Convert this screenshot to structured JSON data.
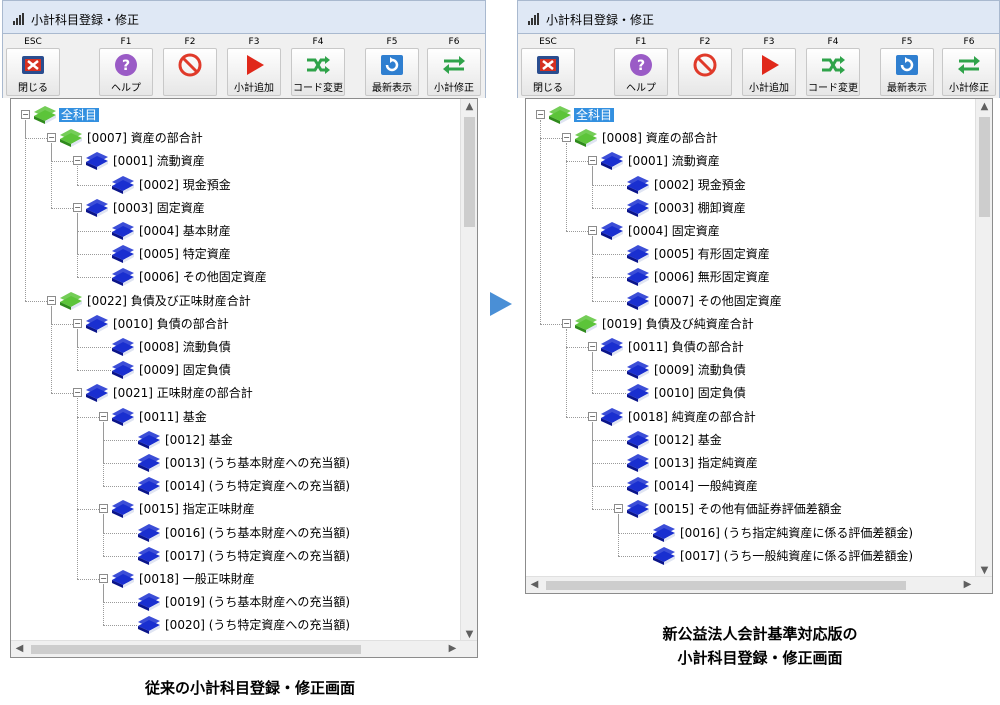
{
  "colors": {
    "accent": "#3390e0",
    "book_blue": "#1a2fd0",
    "book_green": "#5cc43a",
    "arrow": "#4a8fd6"
  },
  "left": {
    "title": "小計科目登録・修正",
    "toolbar": [
      {
        "key": "ESC",
        "label": "閉じる",
        "icon": "close-icon"
      },
      {
        "key": "F1",
        "label": "ヘルプ",
        "icon": "help-icon"
      },
      {
        "key": "F2",
        "label": "",
        "icon": "prohibit-icon"
      },
      {
        "key": "F3",
        "label": "小計追加",
        "icon": "play-icon"
      },
      {
        "key": "F4",
        "label": "コード変更",
        "icon": "shuffle-icon"
      },
      {
        "key": "F5",
        "label": "最新表示",
        "icon": "refresh-icon"
      },
      {
        "key": "F6",
        "label": "小計修正",
        "icon": "swap-icon"
      }
    ],
    "tree": [
      {
        "level": 0,
        "text": "全科目",
        "color": "green",
        "exp": true,
        "sel": true
      },
      {
        "level": 1,
        "text": "[0007] 資産の部合計",
        "color": "green",
        "exp": true
      },
      {
        "level": 2,
        "text": "[0001] 流動資産",
        "color": "blue",
        "exp": true
      },
      {
        "level": 3,
        "text": "[0002] 現金預金",
        "color": "blue"
      },
      {
        "level": 2,
        "text": "[0003] 固定資産",
        "color": "blue",
        "exp": true
      },
      {
        "level": 3,
        "text": "[0004] 基本財産",
        "color": "blue"
      },
      {
        "level": 3,
        "text": "[0005] 特定資産",
        "color": "blue"
      },
      {
        "level": 3,
        "text": "[0006] その他固定資産",
        "color": "blue"
      },
      {
        "level": 1,
        "text": "[0022] 負債及び正味財産合計",
        "color": "green",
        "exp": true
      },
      {
        "level": 2,
        "text": "[0010] 負債の部合計",
        "color": "blue",
        "exp": true
      },
      {
        "level": 3,
        "text": "[0008] 流動負債",
        "color": "blue"
      },
      {
        "level": 3,
        "text": "[0009] 固定負債",
        "color": "blue"
      },
      {
        "level": 2,
        "text": "[0021] 正味財産の部合計",
        "color": "blue",
        "exp": true
      },
      {
        "level": 3,
        "text": "[0011] 基金",
        "color": "blue",
        "exp": true
      },
      {
        "level": 4,
        "text": "[0012] 基金",
        "color": "blue"
      },
      {
        "level": 4,
        "text": "[0013] (うち基本財産への充当額)",
        "color": "blue"
      },
      {
        "level": 4,
        "text": "[0014] (うち特定資産への充当額)",
        "color": "blue"
      },
      {
        "level": 3,
        "text": "[0015] 指定正味財産",
        "color": "blue",
        "exp": true
      },
      {
        "level": 4,
        "text": "[0016] (うち基本財産への充当額)",
        "color": "blue"
      },
      {
        "level": 4,
        "text": "[0017] (うち特定資産への充当額)",
        "color": "blue"
      },
      {
        "level": 3,
        "text": "[0018] 一般正味財産",
        "color": "blue",
        "exp": true
      },
      {
        "level": 4,
        "text": "[0019] (うち基本財産への充当額)",
        "color": "blue"
      },
      {
        "level": 4,
        "text": "[0020] (うち特定資産への充当額)",
        "color": "blue"
      }
    ]
  },
  "right": {
    "title": "小計科目登録・修正",
    "toolbar": [
      {
        "key": "ESC",
        "label": "閉じる",
        "icon": "close-icon"
      },
      {
        "key": "F1",
        "label": "ヘルプ",
        "icon": "help-icon"
      },
      {
        "key": "F2",
        "label": "",
        "icon": "prohibit-icon"
      },
      {
        "key": "F3",
        "label": "小計追加",
        "icon": "play-icon"
      },
      {
        "key": "F4",
        "label": "コード変更",
        "icon": "shuffle-icon"
      },
      {
        "key": "F5",
        "label": "最新表示",
        "icon": "refresh-icon"
      },
      {
        "key": "F6",
        "label": "小計修正",
        "icon": "swap-icon"
      }
    ],
    "tree": [
      {
        "level": 0,
        "text": "全科目",
        "color": "green",
        "exp": true,
        "sel": true
      },
      {
        "level": 1,
        "text": "[0008] 資産の部合計",
        "color": "green",
        "exp": true
      },
      {
        "level": 2,
        "text": "[0001] 流動資産",
        "color": "blue",
        "exp": true
      },
      {
        "level": 3,
        "text": "[0002] 現金預金",
        "color": "blue"
      },
      {
        "level": 3,
        "text": "[0003] 棚卸資産",
        "color": "blue"
      },
      {
        "level": 2,
        "text": "[0004] 固定資産",
        "color": "blue",
        "exp": true
      },
      {
        "level": 3,
        "text": "[0005] 有形固定資産",
        "color": "blue"
      },
      {
        "level": 3,
        "text": "[0006] 無形固定資産",
        "color": "blue"
      },
      {
        "level": 3,
        "text": "[0007] その他固定資産",
        "color": "blue"
      },
      {
        "level": 1,
        "text": "[0019] 負債及び純資産合計",
        "color": "green",
        "exp": true
      },
      {
        "level": 2,
        "text": "[0011] 負債の部合計",
        "color": "blue",
        "exp": true
      },
      {
        "level": 3,
        "text": "[0009] 流動負債",
        "color": "blue"
      },
      {
        "level": 3,
        "text": "[0010] 固定負債",
        "color": "blue"
      },
      {
        "level": 2,
        "text": "[0018] 純資産の部合計",
        "color": "blue",
        "exp": true
      },
      {
        "level": 3,
        "text": "[0012] 基金",
        "color": "blue"
      },
      {
        "level": 3,
        "text": "[0013] 指定純資産",
        "color": "blue"
      },
      {
        "level": 3,
        "text": "[0014] 一般純資産",
        "color": "blue"
      },
      {
        "level": 3,
        "text": "[0015] その他有価証券評価差額金",
        "color": "blue",
        "exp": true
      },
      {
        "level": 4,
        "text": "[0016] (うち指定純資産に係る評価差額金)",
        "color": "blue"
      },
      {
        "level": 4,
        "text": "[0017] (うち一般純資産に係る評価差額金)",
        "color": "blue"
      }
    ]
  },
  "captions": {
    "left": "従来の小計科目登録・修正画面",
    "right_line1": "新公益法人会計基準対応版の",
    "right_line2": "小計科目登録・修正画面"
  }
}
